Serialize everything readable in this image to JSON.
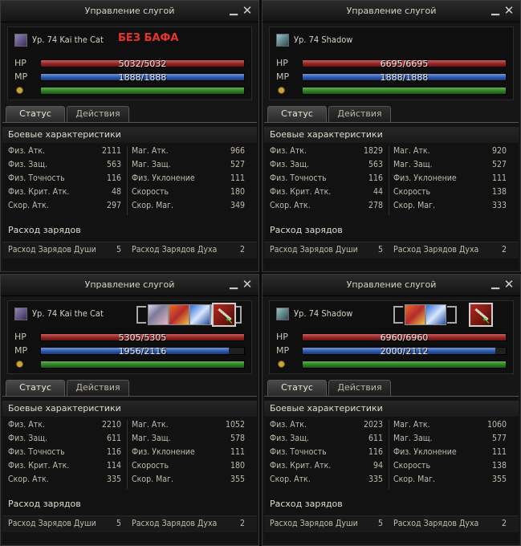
{
  "panels": [
    {
      "title": "Управление слугой",
      "level_name": "Ур. 74 Kai the Cat",
      "note": "БЕЗ БАФА",
      "hp_label": "HP",
      "hp_text": "5032/5032",
      "hp_fill": 1.0,
      "mp_label": "MP",
      "mp_text": "1888/1888",
      "mp_fill": 1.0,
      "xp_fill": 1.0,
      "tabs": [
        "Статус",
        "Действия"
      ],
      "combat_title": "Боевые характеристики",
      "stats": [
        [
          "Физ. Атк.",
          "2111",
          "Маг. Атк.",
          "966"
        ],
        [
          "Физ. Защ.",
          "563",
          "Маг. Защ.",
          "527"
        ],
        [
          "Физ. Точность",
          "116",
          "Физ. Уклонение",
          "111"
        ],
        [
          "Физ. Крит. Атк.",
          "48",
          "Скорость",
          "180"
        ],
        [
          "Скор. Атк.",
          "297",
          "Скор. Маг.",
          "349"
        ]
      ],
      "charges_title": "Расход зарядов",
      "charges": [
        "Расход Зарядов Души",
        "5",
        "Расход Зарядов Духа",
        "2"
      ]
    },
    {
      "title": "Управление слугой",
      "level_name": "Ур. 74 Shadow",
      "hp_label": "HP",
      "hp_text": "6695/6695",
      "hp_fill": 1.0,
      "mp_label": "MP",
      "mp_text": "1888/1888",
      "mp_fill": 1.0,
      "xp_fill": 1.0,
      "tabs": [
        "Статус",
        "Действия"
      ],
      "combat_title": "Боевые характеристики",
      "stats": [
        [
          "Физ. Атк.",
          "1829",
          "Маг. Атк.",
          "920"
        ],
        [
          "Физ. Защ.",
          "563",
          "Маг. Защ.",
          "527"
        ],
        [
          "Физ. Точность",
          "116",
          "Физ. Уклонение",
          "111"
        ],
        [
          "Физ. Крит. Атк.",
          "44",
          "Скорость",
          "138"
        ],
        [
          "Скор. Атк.",
          "278",
          "Скор. Маг.",
          "333"
        ]
      ],
      "charges_title": "Расход зарядов",
      "charges": [
        "Расход Зарядов Души",
        "5",
        "Расход Зарядов Духа",
        "2"
      ]
    },
    {
      "title": "Управление слугой",
      "level_name": "Ур. 74 Kai the Cat",
      "hp_label": "HP",
      "hp_text": "5305/5305",
      "hp_fill": 1.0,
      "mp_label": "MP",
      "mp_text": "1956/2116",
      "mp_fill": 0.924,
      "xp_fill": 1.0,
      "tabs": [
        "Статус",
        "Действия"
      ],
      "combat_title": "Боевые характеристики",
      "stats": [
        [
          "Физ. Атк.",
          "2210",
          "Маг. Атк.",
          "1052"
        ],
        [
          "Физ. Защ.",
          "611",
          "Маг. Защ.",
          "578"
        ],
        [
          "Физ. Точность",
          "116",
          "Физ. Уклонение",
          "111"
        ],
        [
          "Физ. Крит. Атк.",
          "114",
          "Скорость",
          "180"
        ],
        [
          "Скор. Атк.",
          "335",
          "Скор. Маг.",
          "355"
        ]
      ],
      "charges_title": "Расход зарядов",
      "charges": [
        "Расход Зарядов Души",
        "5",
        "Расход Зарядов Духа",
        "2"
      ]
    },
    {
      "title": "Управление слугой",
      "level_name": "Ур. 74 Shadow",
      "hp_label": "HP",
      "hp_text": "6960/6960",
      "hp_fill": 1.0,
      "mp_label": "MP",
      "mp_text": "2000/2112",
      "mp_fill": 0.947,
      "xp_fill": 1.0,
      "tabs": [
        "Статус",
        "Действия"
      ],
      "combat_title": "Боевые характеристики",
      "stats": [
        [
          "Физ. Атк.",
          "2023",
          "Маг. Атк.",
          "1060"
        ],
        [
          "Физ. Защ.",
          "611",
          "Маг. Защ.",
          "577"
        ],
        [
          "Физ. Точность",
          "116",
          "Физ. Уклонение",
          "111"
        ],
        [
          "Физ. Крит. Атк.",
          "94",
          "Скорость",
          "138"
        ],
        [
          "Скор. Атк.",
          "335",
          "Скор. Маг.",
          "355"
        ]
      ],
      "charges_title": "Расход зарядов",
      "charges": [
        "Расход Зарядов Души",
        "5",
        "Расход Зарядов Духа",
        "2"
      ]
    }
  ]
}
